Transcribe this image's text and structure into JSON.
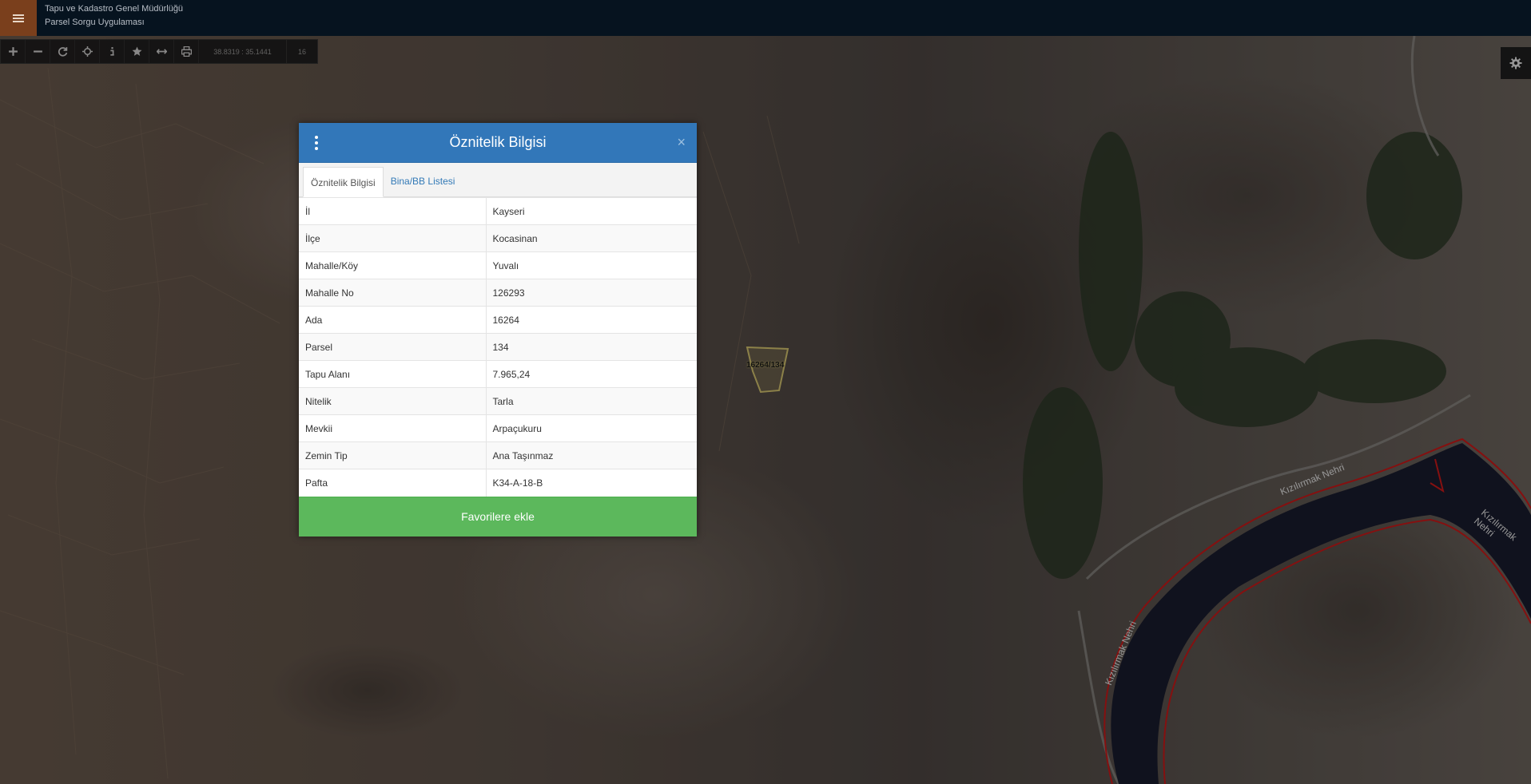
{
  "header": {
    "org_name": "Tapu ve Kadastro Genel Müdürlüğü",
    "app_name": "Parsel Sorgu Uygulaması"
  },
  "toolbar": {
    "tools": [
      "zoom-in",
      "zoom-out",
      "refresh",
      "locate",
      "info",
      "favorite",
      "measure",
      "print"
    ],
    "coordinates": "38.8319 : 35.1441",
    "zoom_level": "16"
  },
  "map": {
    "parcel_label": "16264/134",
    "river_labels": [
      "Kızılırmak Nehri",
      "Kızılırmak Nehri",
      "Kızılırmak Nehri"
    ],
    "colors": {
      "river_border": "#cc1a1a",
      "parcel_outline": "#d8c770"
    }
  },
  "dialog": {
    "title": "Öznitelik Bilgisi",
    "tabs": [
      {
        "label": "Öznitelik Bilgisi",
        "active": true
      },
      {
        "label": "Bina/BB Listesi",
        "active": false
      }
    ],
    "rows": [
      {
        "key": "İl",
        "value": "Kayseri"
      },
      {
        "key": "İlçe",
        "value": "Kocasinan"
      },
      {
        "key": "Mahalle/Köy",
        "value": "Yuvalı"
      },
      {
        "key": "Mahalle No",
        "value": "126293"
      },
      {
        "key": "Ada",
        "value": "16264"
      },
      {
        "key": "Parsel",
        "value": "134"
      },
      {
        "key": "Tapu Alanı",
        "value": "7.965,24"
      },
      {
        "key": "Nitelik",
        "value": "Tarla"
      },
      {
        "key": "Mevkii",
        "value": "Arpaçukuru"
      },
      {
        "key": "Zemin Tip",
        "value": "Ana Taşınmaz"
      },
      {
        "key": "Pafta",
        "value": "K34-A-18-B"
      }
    ],
    "favorite_button": "Favorilere ekle",
    "colors": {
      "header": "#3277b9",
      "favorite": "#5cb85c"
    }
  }
}
